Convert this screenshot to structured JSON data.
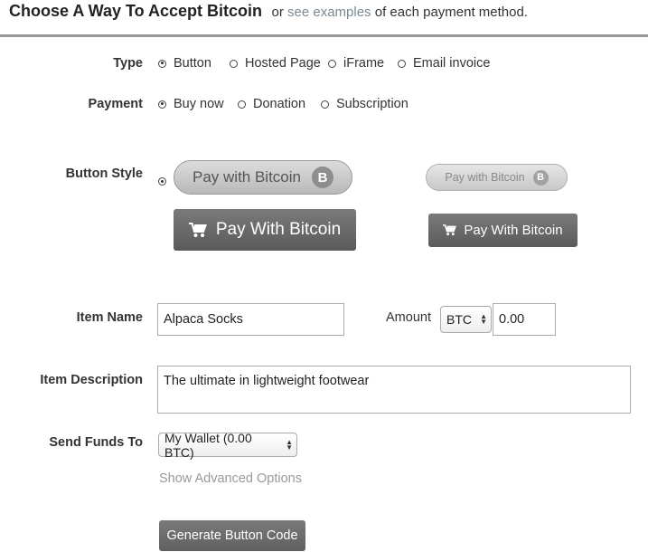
{
  "header": {
    "title": "Choose A Way To Accept Bitcoin",
    "subtitle_pre": "or",
    "subtitle_link": "see examples",
    "subtitle_post": "of each payment method."
  },
  "type": {
    "label": "Type",
    "options": [
      "Button",
      "Hosted Page",
      "iFrame",
      "Email invoice"
    ],
    "selected": "Button"
  },
  "payment": {
    "label": "Payment",
    "options": [
      "Buy now",
      "Donation",
      "Subscription"
    ],
    "selected": "Buy now"
  },
  "button_style": {
    "label": "Button Style",
    "selected": "Large Pill",
    "styles": [
      {
        "label": "Pay with Bitcoin",
        "coin": "B"
      },
      {
        "label": "Pay with Bitcoin",
        "coin": "B"
      },
      {
        "label": "Pay With Bitcoin"
      },
      {
        "label": "Pay With Bitcoin"
      }
    ]
  },
  "item_name": {
    "label": "Item Name",
    "value": "Alpaca Socks"
  },
  "amount": {
    "label": "Amount",
    "currency": "BTC",
    "value": "0.00"
  },
  "item_description": {
    "label": "Item Description",
    "value": "The ultimate in lightweight footwear"
  },
  "send_funds": {
    "label": "Send Funds To",
    "value": "My Wallet (0.00 BTC)"
  },
  "advanced_link": "Show Advanced Options",
  "generate_button": "Generate Button Code",
  "colors": {
    "accent": "#6b6b6b",
    "link": "#7a8a94",
    "rule": "#9a9a9a"
  }
}
